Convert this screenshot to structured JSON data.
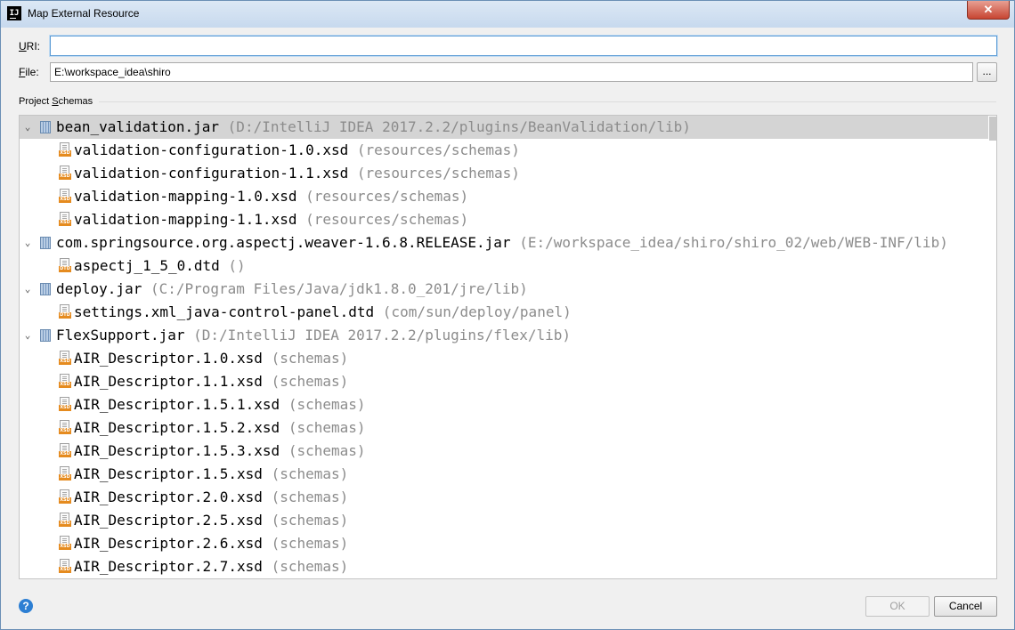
{
  "window": {
    "title": "Map External Resource",
    "app_icon_text": "IJ",
    "close_label": "✕"
  },
  "form": {
    "uri_label_mnemonic": "U",
    "uri_label_rest": "RI:",
    "uri_value": "",
    "file_label_mnemonic": "F",
    "file_label_rest": "ile:",
    "file_value": "E:\\workspace_idea\\shiro",
    "browse_label": "..."
  },
  "schemas": {
    "section_label_pre": "Project ",
    "section_label_mnemonic": "S",
    "section_label_post": "chemas",
    "rows": [
      {
        "kind": "jar",
        "name": "bean_validation.jar",
        "path": "(D:/IntelliJ IDEA 2017.2.2/plugins/BeanValidation/lib)",
        "selected": true
      },
      {
        "kind": "file",
        "ext": "XSD",
        "name": "validation-configuration-1.0.xsd",
        "path": "(resources/schemas)"
      },
      {
        "kind": "file",
        "ext": "XSD",
        "name": "validation-configuration-1.1.xsd",
        "path": "(resources/schemas)"
      },
      {
        "kind": "file",
        "ext": "XSD",
        "name": "validation-mapping-1.0.xsd",
        "path": "(resources/schemas)"
      },
      {
        "kind": "file",
        "ext": "XSD",
        "name": "validation-mapping-1.1.xsd",
        "path": "(resources/schemas)"
      },
      {
        "kind": "jar",
        "name": "com.springsource.org.aspectj.weaver-1.6.8.RELEASE.jar",
        "path": "(E:/workspace_idea/shiro/shiro_02/web/WEB-INF/lib)"
      },
      {
        "kind": "file",
        "ext": "DTD",
        "name": "aspectj_1_5_0.dtd",
        "path": "()"
      },
      {
        "kind": "jar",
        "name": "deploy.jar",
        "path": "(C:/Program Files/Java/jdk1.8.0_201/jre/lib)"
      },
      {
        "kind": "file",
        "ext": "DTD",
        "name": "settings.xml_java-control-panel.dtd",
        "path": "(com/sun/deploy/panel)"
      },
      {
        "kind": "jar",
        "name": "FlexSupport.jar",
        "path": "(D:/IntelliJ IDEA 2017.2.2/plugins/flex/lib)"
      },
      {
        "kind": "file",
        "ext": "XSD",
        "name": "AIR_Descriptor.1.0.xsd",
        "path": "(schemas)"
      },
      {
        "kind": "file",
        "ext": "XSD",
        "name": "AIR_Descriptor.1.1.xsd",
        "path": "(schemas)"
      },
      {
        "kind": "file",
        "ext": "XSD",
        "name": "AIR_Descriptor.1.5.1.xsd",
        "path": "(schemas)"
      },
      {
        "kind": "file",
        "ext": "XSD",
        "name": "AIR_Descriptor.1.5.2.xsd",
        "path": "(schemas)"
      },
      {
        "kind": "file",
        "ext": "XSD",
        "name": "AIR_Descriptor.1.5.3.xsd",
        "path": "(schemas)"
      },
      {
        "kind": "file",
        "ext": "XSD",
        "name": "AIR_Descriptor.1.5.xsd",
        "path": "(schemas)"
      },
      {
        "kind": "file",
        "ext": "XSD",
        "name": "AIR_Descriptor.2.0.xsd",
        "path": "(schemas)"
      },
      {
        "kind": "file",
        "ext": "XSD",
        "name": "AIR_Descriptor.2.5.xsd",
        "path": "(schemas)"
      },
      {
        "kind": "file",
        "ext": "XSD",
        "name": "AIR_Descriptor.2.6.xsd",
        "path": "(schemas)"
      },
      {
        "kind": "file",
        "ext": "XSD",
        "name": "AIR_Descriptor.2.7.xsd",
        "path": "(schemas)"
      }
    ]
  },
  "footer": {
    "help_label": "?",
    "ok_label": "OK",
    "cancel_label": "Cancel"
  },
  "colors": {
    "selection": "#d4d4d4",
    "path_text": "#8c8c8c",
    "file_tag": "#e58b1f",
    "help_blue": "#2d7fd3"
  },
  "icons": {
    "jar": "jar-archive-icon",
    "file": "schema-file-icon",
    "expand": "chevron-down-icon",
    "help": "help-icon"
  }
}
